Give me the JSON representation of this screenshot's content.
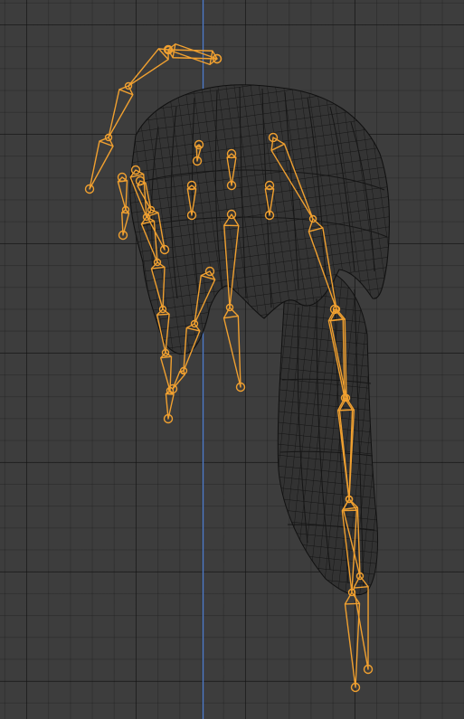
{
  "viewport": {
    "name": "3d-viewport",
    "view_axis": "vertical-z-axis",
    "colors": {
      "background": "#3d3d3d",
      "grid_minor": "#383838",
      "grid_major": "#2e2e2e",
      "axis_line": "#4d79c7",
      "mesh_fill": "#343434",
      "mesh_wire": "#111111",
      "bone_selected": "#f0a030"
    }
  },
  "objects": [
    {
      "name": "hair-mesh",
      "type": "mesh",
      "display": "wireframe"
    },
    {
      "name": "hair-armature",
      "type": "armature",
      "display": "octahedral",
      "selected": true
    }
  ]
}
